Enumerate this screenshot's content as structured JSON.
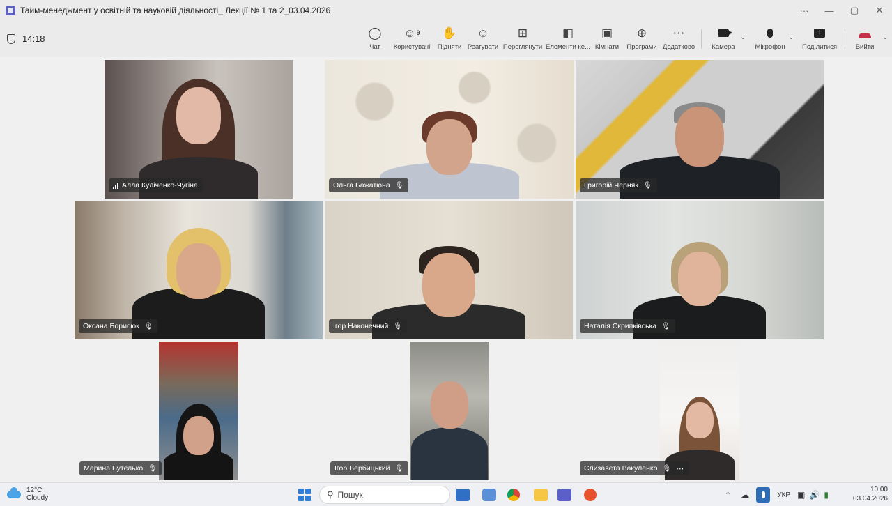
{
  "window": {
    "title": "Тайм-менеджмент у освітній та науковій діяльності_ Лекції № 1 та 2_03.04.2026",
    "controls": [
      "···",
      "—",
      "▢",
      "✕"
    ]
  },
  "meeting": {
    "elapsed": "14:18"
  },
  "toolbar": {
    "chat": "Чат",
    "people": "Користувачі",
    "people_count": "9",
    "raise": "Підняти",
    "react": "Реагувати",
    "view": "Переглянути",
    "apps_content": "Елементи ке...",
    "rooms": "Кімнати",
    "apps": "Програми",
    "more": "Додатково",
    "camera": "Камера",
    "mic": "Мікрофон",
    "share": "Поділитися",
    "leave": "Вийти"
  },
  "participants": [
    {
      "name": "Алла Куліченко-Чугіна",
      "muted": false
    },
    {
      "name": "Ольга Бажатюна",
      "muted": true
    },
    {
      "name": "Григорій Черняк",
      "muted": true
    },
    {
      "name": "Оксана Борисюк",
      "muted": true
    },
    {
      "name": "Ігор Наконечний",
      "muted": true
    },
    {
      "name": "Наталія Скрипківська",
      "muted": true
    },
    {
      "name": "Марина Бутелько",
      "muted": true
    },
    {
      "name": "Ігор Вербицький",
      "muted": true
    },
    {
      "name": "Єлизавета Вакуленко",
      "muted": true
    }
  ],
  "taskbar": {
    "temperature": "12°C",
    "condition": "Cloudy",
    "search_placeholder": "Пошук",
    "language": "УКР",
    "time": "10:00",
    "date": "03.04.2026"
  },
  "colors": {
    "leave": "#c4314b",
    "accent": "#5b5fc7"
  }
}
